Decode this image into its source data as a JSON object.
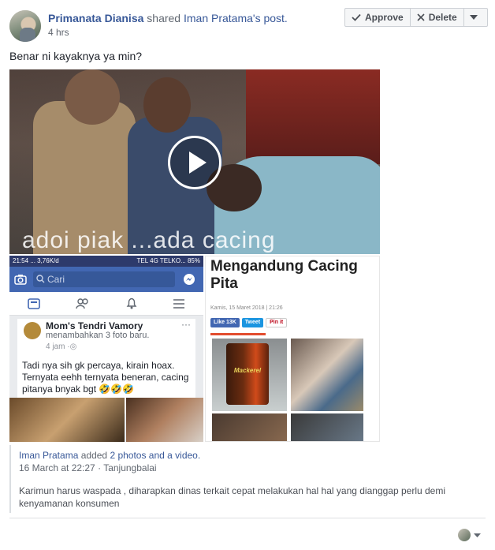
{
  "header": {
    "actor_name": "Primanata Dianisa",
    "action": "shared",
    "shared_post": "Iman Pratama's post.",
    "time": "4 hrs"
  },
  "moderation": {
    "approve_label": "Approve",
    "delete_label": "Delete"
  },
  "post": {
    "caption": "Benar ni kayaknya ya min?"
  },
  "video": {
    "overlay_text": "adoi piak ...ada cacing"
  },
  "fb_screenshot": {
    "status_left": "21:54 ... 3,76K/d",
    "status_right": "TEL 4G TELKO... 85%",
    "search_placeholder": "Cari",
    "author": "Mom's Tendri Vamory",
    "subtitle": "menambahkan 3 foto baru.",
    "time": "4 jam",
    "more": "···",
    "text": "Tadi nya sih gk percaya, kirain hoax. Ternyata eehh ternyata beneran, cacing pitanya bnyak bgt 🤣🤣🤣"
  },
  "article_screenshot": {
    "title": "Mengandung Cacing Pita",
    "date": "Kamis, 15 Maret 2018 | 21:26",
    "like_label": "Like 13K",
    "tweet_label": "Tweet",
    "pin_label": "Pin it",
    "can_label": "Mackerel"
  },
  "attachment": {
    "author": "Iman Pratama",
    "added_text": "added",
    "added_link": "2 photos and a video.",
    "date": "16 March at 22:27",
    "separator": " · ",
    "location": "Tanjungbalai",
    "description": "Karimun harus waspada , diharapkan dinas terkait cepat melakukan hal hal yang dianggap perlu demi kenyamanan konsumen"
  },
  "colors": {
    "link": "#385898",
    "fb_blue": "#4267b2",
    "text": "#1d2129",
    "muted": "#616770"
  },
  "icons": [
    "checkmark-icon",
    "x-icon",
    "caret-down-icon",
    "play-icon",
    "camera-icon",
    "search-icon",
    "messenger-icon",
    "news-feed-icon",
    "friends-icon",
    "bell-icon",
    "menu-icon",
    "globe-icon"
  ]
}
